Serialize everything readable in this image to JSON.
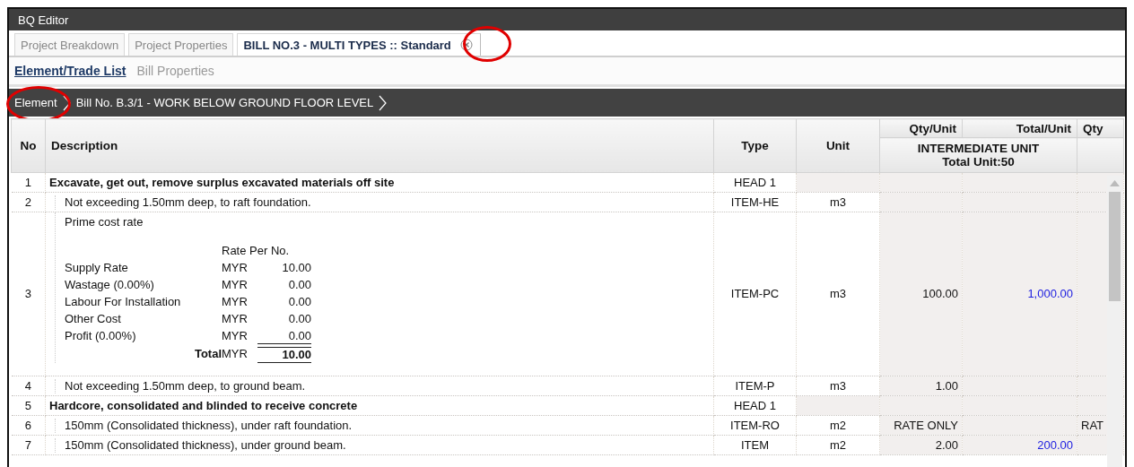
{
  "window": {
    "title": "BQ Editor"
  },
  "tabs": [
    {
      "label": "Project Breakdown",
      "selected": false,
      "closable": false
    },
    {
      "label": "Project Properties",
      "selected": false,
      "closable": false
    },
    {
      "label": "BILL NO.3 - MULTI TYPES :: Standard",
      "selected": true,
      "closable": true,
      "close_circled": true
    }
  ],
  "subtabs": [
    {
      "label": "Element/Trade List",
      "selected": true
    },
    {
      "label": "Bill Properties",
      "selected": false
    }
  ],
  "breadcrumb": [
    {
      "label": "Element",
      "circled": true
    },
    {
      "label": "Bill No. B.3/1 - WORK BELOW GROUND FLOOR LEVEL",
      "circled": false
    }
  ],
  "table": {
    "columns": [
      "No",
      "Description",
      "Type",
      "Unit",
      "Qty/Unit",
      "Total/Unit",
      "Qty"
    ],
    "group_header": {
      "title": "INTERMEDIATE UNIT",
      "subtitle": "Total Unit:50"
    },
    "rows": [
      {
        "no": "1",
        "kind": "head",
        "description": "Excavate, get out, remove surplus excavated materials off site",
        "type": "HEAD 1"
      },
      {
        "no": "2",
        "kind": "item",
        "description": "Not exceeding 1.50mm deep, to raft foundation.",
        "type": "ITEM-HE",
        "unit": "m3"
      },
      {
        "no": "3",
        "kind": "breakdown",
        "description": "Prime cost rate",
        "type": "ITEM-PC",
        "unit": "m3",
        "qty": "100.00",
        "total": "1,000.00",
        "breakdown": {
          "heading": "Rate Per No.",
          "lines": [
            {
              "label": "Supply Rate",
              "currency": "MYR",
              "amount": "10.00"
            },
            {
              "label": "Wastage (0.00%)",
              "currency": "MYR",
              "amount": "0.00"
            },
            {
              "label": "Labour For Installation",
              "currency": "MYR",
              "amount": "0.00"
            },
            {
              "label": "Other Cost",
              "currency": "MYR",
              "amount": "0.00"
            },
            {
              "label": "Profit (0.00%)",
              "currency": "MYR",
              "amount": "0.00"
            }
          ],
          "total": {
            "label": "Total",
            "currency": "MYR",
            "amount": "10.00"
          }
        }
      },
      {
        "no": "4",
        "kind": "item",
        "description": "Not exceeding 1.50mm deep, to ground beam.",
        "type": "ITEM-P",
        "unit": "m3",
        "qty": "1.00"
      },
      {
        "no": "5",
        "kind": "head",
        "description": "Hardcore, consolidated and blinded to receive concrete",
        "type": "HEAD 1"
      },
      {
        "no": "6",
        "kind": "item",
        "description": "150mm (Consolidated thickness), under raft foundation.",
        "type": "ITEM-RO",
        "unit": "m2",
        "qty": "RATE ONLY",
        "column_7": "RAT"
      },
      {
        "no": "7",
        "kind": "item",
        "description": "150mm (Consolidated thickness), under ground beam.",
        "type": "ITEM",
        "unit": "m2",
        "qty": "2.00",
        "total": "200.00"
      }
    ]
  }
}
